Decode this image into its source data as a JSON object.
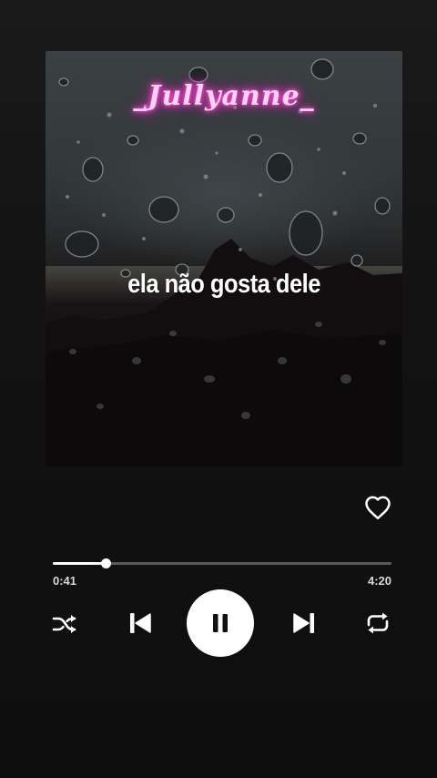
{
  "artwork": {
    "watermark": "_Jullyanne_",
    "lyric": "ela não gosta dele"
  },
  "player": {
    "elapsed": "0:41",
    "total": "4:20",
    "progress_fraction": 0.157,
    "liked": false
  },
  "icons": {
    "like": "heart-outline-icon",
    "shuffle": "shuffle-icon",
    "previous": "skip-previous-icon",
    "play_pause": "pause-icon",
    "next": "skip-next-icon",
    "repeat": "repeat-icon"
  },
  "colors": {
    "background": "#121212",
    "accent": "#ffffff",
    "track": "#5a5a5a",
    "watermark_glow": "#ff3ccf"
  }
}
